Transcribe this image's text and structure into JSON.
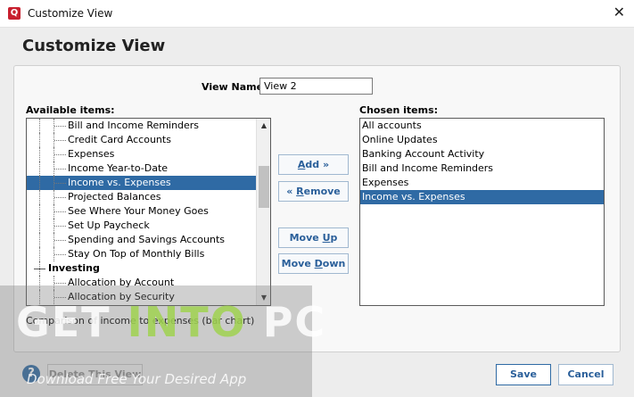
{
  "window": {
    "title": "Customize View",
    "app_icon": "Q",
    "close": "✕"
  },
  "heading": "Customize View",
  "view_name": {
    "label": "View Name:",
    "value": "View 2"
  },
  "available": {
    "label": "Available items:",
    "rows": [
      {
        "text": "Bill and Income Reminders",
        "level": 2,
        "selected": false
      },
      {
        "text": "Credit Card Accounts",
        "level": 2,
        "selected": false
      },
      {
        "text": "Expenses",
        "level": 2,
        "selected": false
      },
      {
        "text": "Income Year-to-Date",
        "level": 2,
        "selected": false
      },
      {
        "text": "Income vs. Expenses",
        "level": 2,
        "selected": true
      },
      {
        "text": "Projected Balances",
        "level": 2,
        "selected": false
      },
      {
        "text": "See Where Your Money Goes",
        "level": 2,
        "selected": false
      },
      {
        "text": "Set Up Paycheck",
        "level": 2,
        "selected": false
      },
      {
        "text": "Spending and Savings Accounts",
        "level": 2,
        "selected": false
      },
      {
        "text": "Stay On Top of Monthly Bills",
        "level": 2,
        "selected": false
      },
      {
        "text": "Investing",
        "level": 1,
        "selected": false
      },
      {
        "text": "Allocation by Account",
        "level": 2,
        "selected": false
      },
      {
        "text": "Allocation by Security",
        "level": 2,
        "selected": false
      }
    ],
    "scroll_up": "▲",
    "scroll_down": "▼"
  },
  "buttons": {
    "add": {
      "pre": "",
      "key": "A",
      "post": "dd »"
    },
    "remove": {
      "pre": "« ",
      "key": "R",
      "post": "emove"
    },
    "move_up": {
      "pre": "Move ",
      "key": "U",
      "post": "p"
    },
    "move_down": {
      "pre": "Move ",
      "key": "D",
      "post": "own"
    }
  },
  "chosen": {
    "label": "Chosen items:",
    "rows": [
      {
        "text": "All accounts",
        "selected": false
      },
      {
        "text": "Online Updates",
        "selected": false
      },
      {
        "text": "Banking Account Activity",
        "selected": false
      },
      {
        "text": "Bill and Income Reminders",
        "selected": false
      },
      {
        "text": "Expenses",
        "selected": false
      },
      {
        "text": "Income vs. Expenses",
        "selected": true
      }
    ]
  },
  "description": "Comparison of income to expenses (bar chart)",
  "footer": {
    "help": "?",
    "delete_label": "Delete This View",
    "save_label": "Save",
    "cancel_label": "Cancel"
  },
  "watermark": {
    "big_pre": "GET ",
    "big_acc": "INTO",
    "big_post": " PC",
    "sub": "Download Free Your Desired App"
  },
  "colors": {
    "selection": "#2f6aa4",
    "accent_text": "#2a5f9a"
  }
}
